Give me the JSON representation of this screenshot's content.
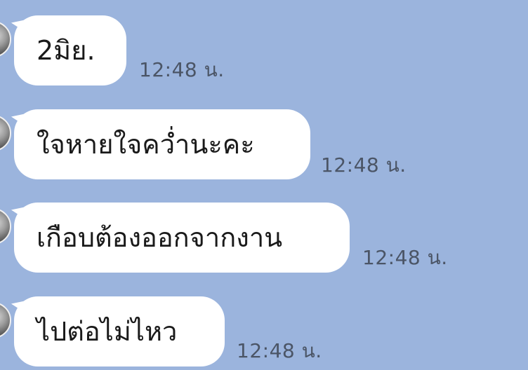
{
  "chat": {
    "messages": [
      {
        "text": "2มิย.",
        "time": "12:48 น."
      },
      {
        "text": "ใจหายใจคว่ำนะคะ",
        "time": "12:48 น."
      },
      {
        "text": "เกือบต้องออกจากงาน",
        "time": "12:48 น."
      },
      {
        "text": "ไปต่อไม่ไหว",
        "time": "12:48 น."
      }
    ]
  },
  "colors": {
    "background": "#9bb4dd",
    "bubble": "#ffffff",
    "text": "#1a1a1a",
    "time": "#4b5566"
  }
}
